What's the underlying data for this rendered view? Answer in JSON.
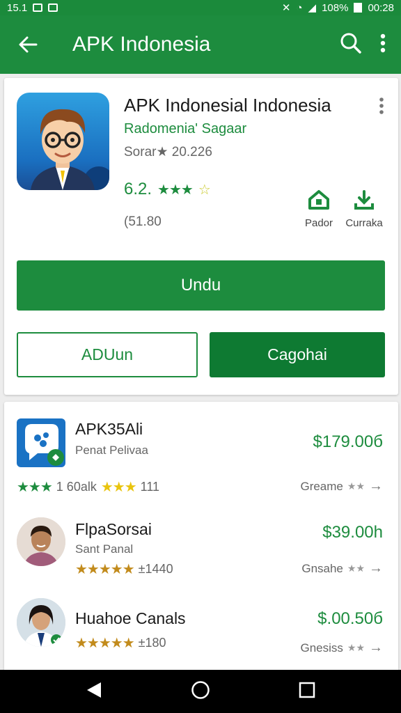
{
  "status_bar": {
    "time": "15.1",
    "battery": "108%",
    "clock": "00:28"
  },
  "app_bar": {
    "title": "APK Indonesia"
  },
  "app": {
    "name": "APK Indonesial Indonesia",
    "developer": "Radomenia' Sagaar",
    "meta": "Sorar★ 20.226",
    "rating": "6.2.",
    "rating_stars": "★★★",
    "count": "(51.80",
    "action_1_label": "Pador",
    "action_2_label": "Curraka",
    "primary_button": "Undu",
    "outline_button": "ADUun",
    "dark_button": "Cagohai"
  },
  "list": [
    {
      "name": "APK35Ali",
      "subtitle": "Penat Pelivaa",
      "price": "$179.00б",
      "stars_label": "★★★",
      "rating_text": "1 60alk",
      "stars_label_2": "★★★",
      "count": "111",
      "genre": "Greame"
    },
    {
      "name": "FlpaSorsai",
      "subtitle": "Sant Panal",
      "price": "$39.00h",
      "stars_label": "★★★★★",
      "count": "±1440",
      "genre": "Gnsahe"
    },
    {
      "name": "Huahoe Canals",
      "subtitle": "",
      "price": "$.00.50б",
      "stars_label": "★★★★★",
      "count": "±180",
      "genre": "Gnesiss"
    }
  ],
  "colors": {
    "primary": "#1d8c3e",
    "dark_primary": "#0e7a32",
    "star_yellow": "#e9c40e",
    "star_gold": "#c28b1c"
  }
}
